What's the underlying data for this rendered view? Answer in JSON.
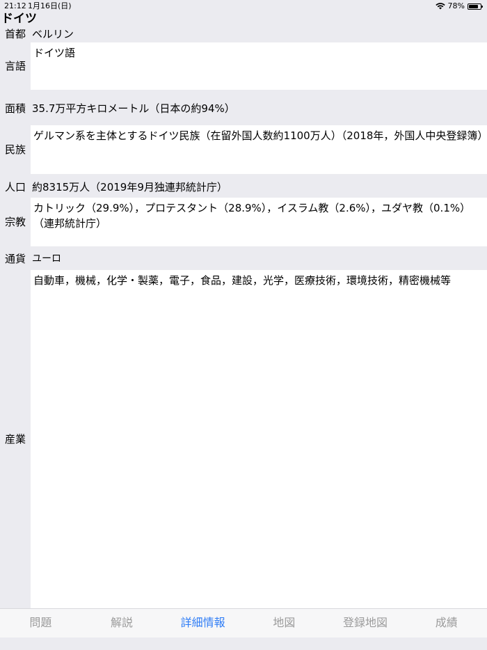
{
  "status_bar": {
    "time": "21:12",
    "date": "1月16日(日)",
    "wifi_icon": "wifi-icon",
    "battery_text": "78%",
    "battery_icon": "battery-icon"
  },
  "country": {
    "name": "ドイツ"
  },
  "rows": {
    "capital": {
      "label": "首都",
      "value": "ベルリン"
    },
    "language": {
      "label": "言語",
      "value": "ドイツ語"
    },
    "area": {
      "label": "面積",
      "value": "35.7万平方キロメートル（日本の約94%）"
    },
    "ethnicity": {
      "label": "民族",
      "value": "ゲルマン系を主体とするドイツ民族（在留外国人数約1100万人）（2018年，外国人中央登録簿）"
    },
    "population": {
      "label": "人口",
      "value": "約8315万人（2019年9月独連邦統計庁）"
    },
    "religion": {
      "label": "宗教",
      "value": "カトリック（29.9%），プロテスタント（28.9%），イスラム教（2.6%），ユダヤ教（0.1%）（連邦統計庁）"
    },
    "currency": {
      "label": "通貨",
      "value": "ユーロ"
    },
    "industry": {
      "label": "産業",
      "value": "自動車，機械，化学・製薬，電子，食品，建設，光学，医療技術，環境技術，精密機械等"
    }
  },
  "tabs": {
    "questions": "問題",
    "explanation": "解説",
    "details": "詳細情報",
    "map": "地図",
    "saved_map": "登録地図",
    "results": "成績"
  },
  "colors": {
    "accent": "#2f7df6",
    "inactive": "#9b9b9b",
    "background": "#ebebf0"
  }
}
